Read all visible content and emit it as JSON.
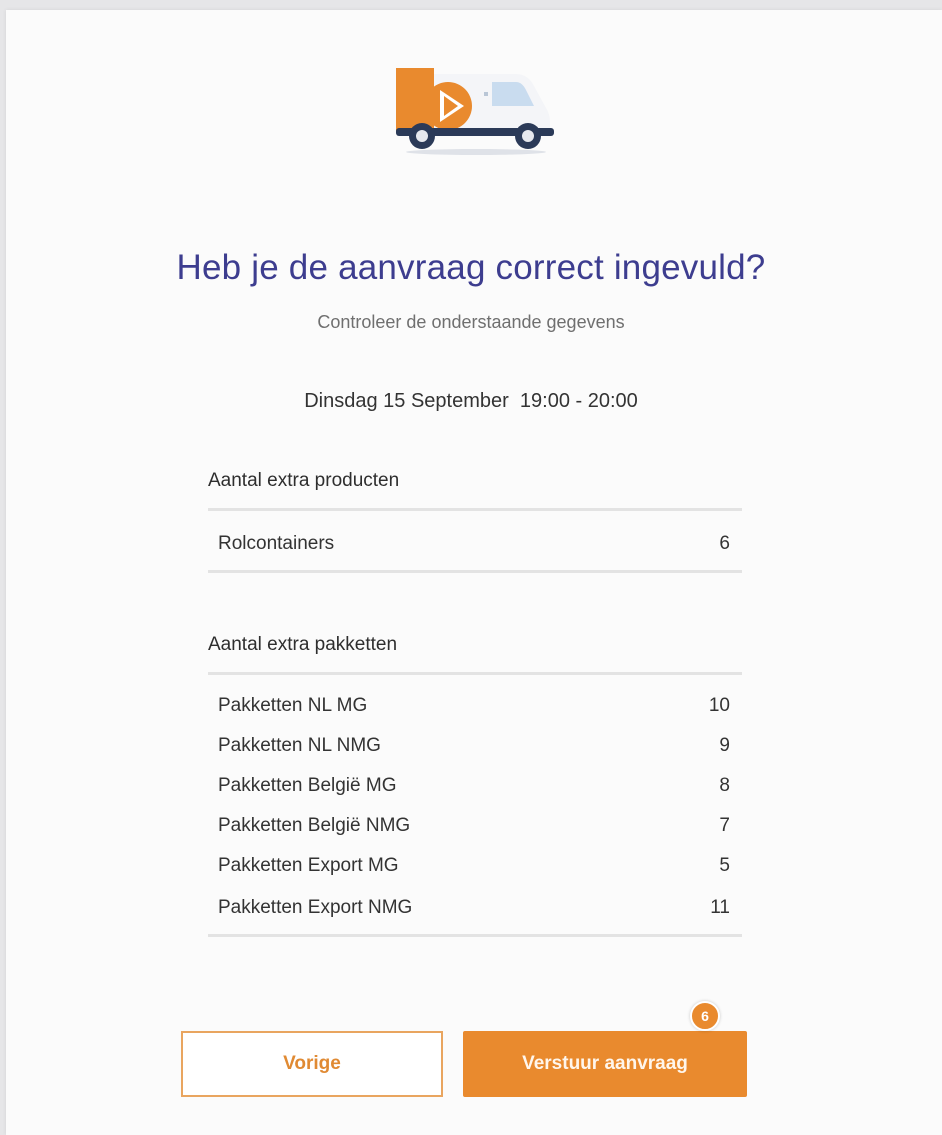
{
  "header": {
    "title": "Heb je de aanvraag correct ingevuld?",
    "subtitle": "Controleer de onderstaande gegevens"
  },
  "appointment": {
    "date_time": "Dinsdag 15 September  19:00 - 20:00"
  },
  "extra_products": {
    "label": "Aantal extra producten",
    "rows": [
      {
        "name": "Rolcontainers",
        "value": "6"
      }
    ]
  },
  "extra_packages": {
    "label": "Aantal extra pakketten",
    "rows": [
      {
        "name": "Pakketten NL MG",
        "value": "10"
      },
      {
        "name": "Pakketten NL NMG",
        "value": "9"
      },
      {
        "name": "Pakketten België MG",
        "value": "8"
      },
      {
        "name": "Pakketten België NMG",
        "value": "7"
      },
      {
        "name": "Pakketten Export MG",
        "value": "5"
      },
      {
        "name": "Pakketten Export NMG",
        "value": "11"
      }
    ]
  },
  "actions": {
    "previous_label": "Vorige",
    "submit_label": "Verstuur aanvraag",
    "step_badge": "6"
  },
  "icons": {
    "logo": "delivery-van-icon"
  },
  "colors": {
    "accent": "#e98a2e",
    "title": "#3d3d8f",
    "text": "#333333",
    "divider": "#e3e3e3"
  }
}
